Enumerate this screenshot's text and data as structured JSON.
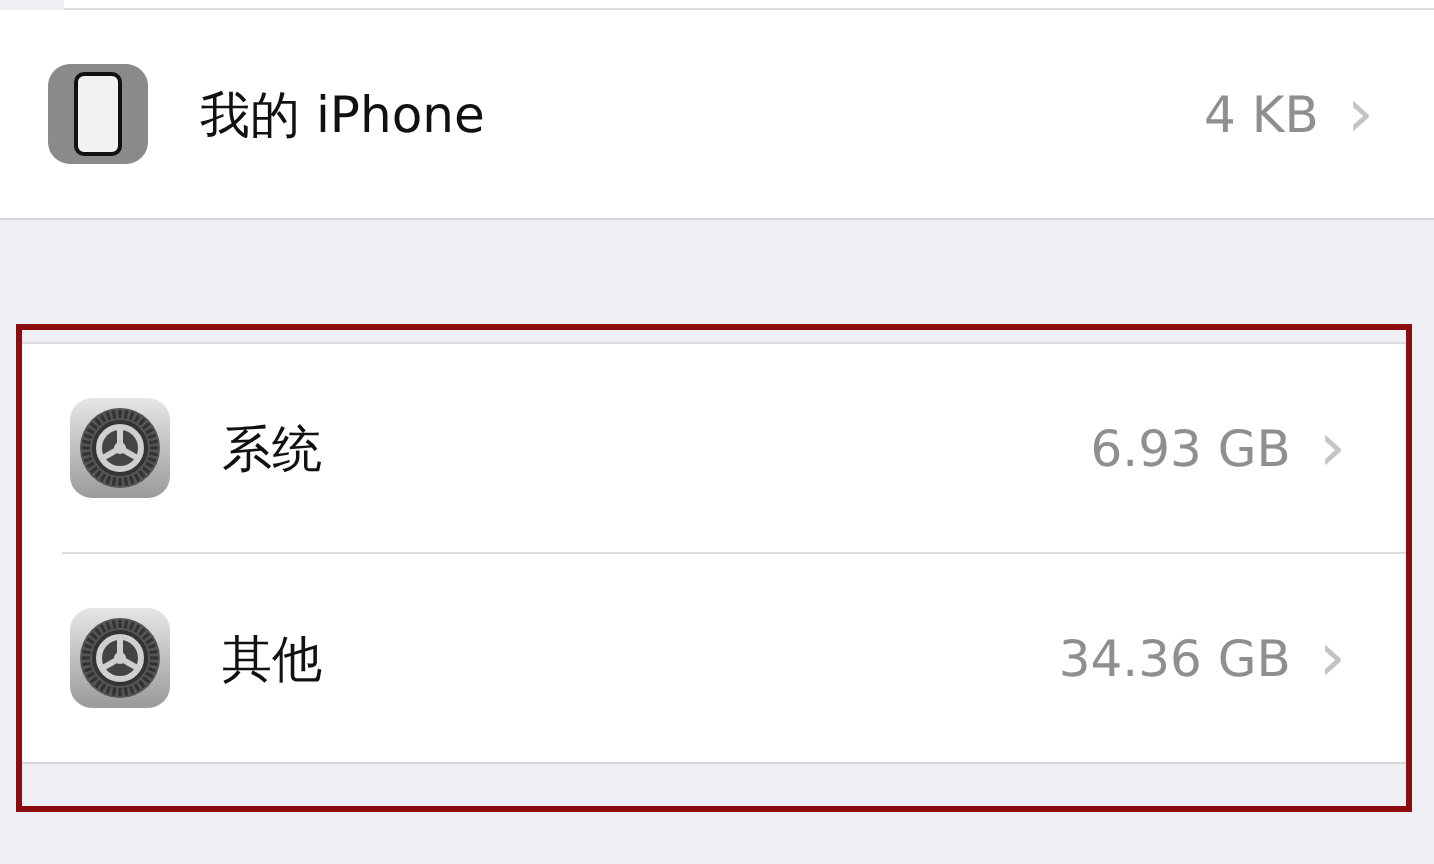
{
  "sections": [
    {
      "highlighted": false,
      "rows": [
        {
          "kind": "device",
          "label": "我的 iPhone",
          "value": "4 KB",
          "chevron": "›"
        }
      ]
    },
    {
      "highlighted": true,
      "rows": [
        {
          "kind": "settings",
          "label": "系统",
          "value": "6.93 GB",
          "chevron": "›"
        },
        {
          "kind": "settings",
          "label": "其他",
          "value": "34.36 GB",
          "chevron": "›"
        }
      ]
    }
  ]
}
